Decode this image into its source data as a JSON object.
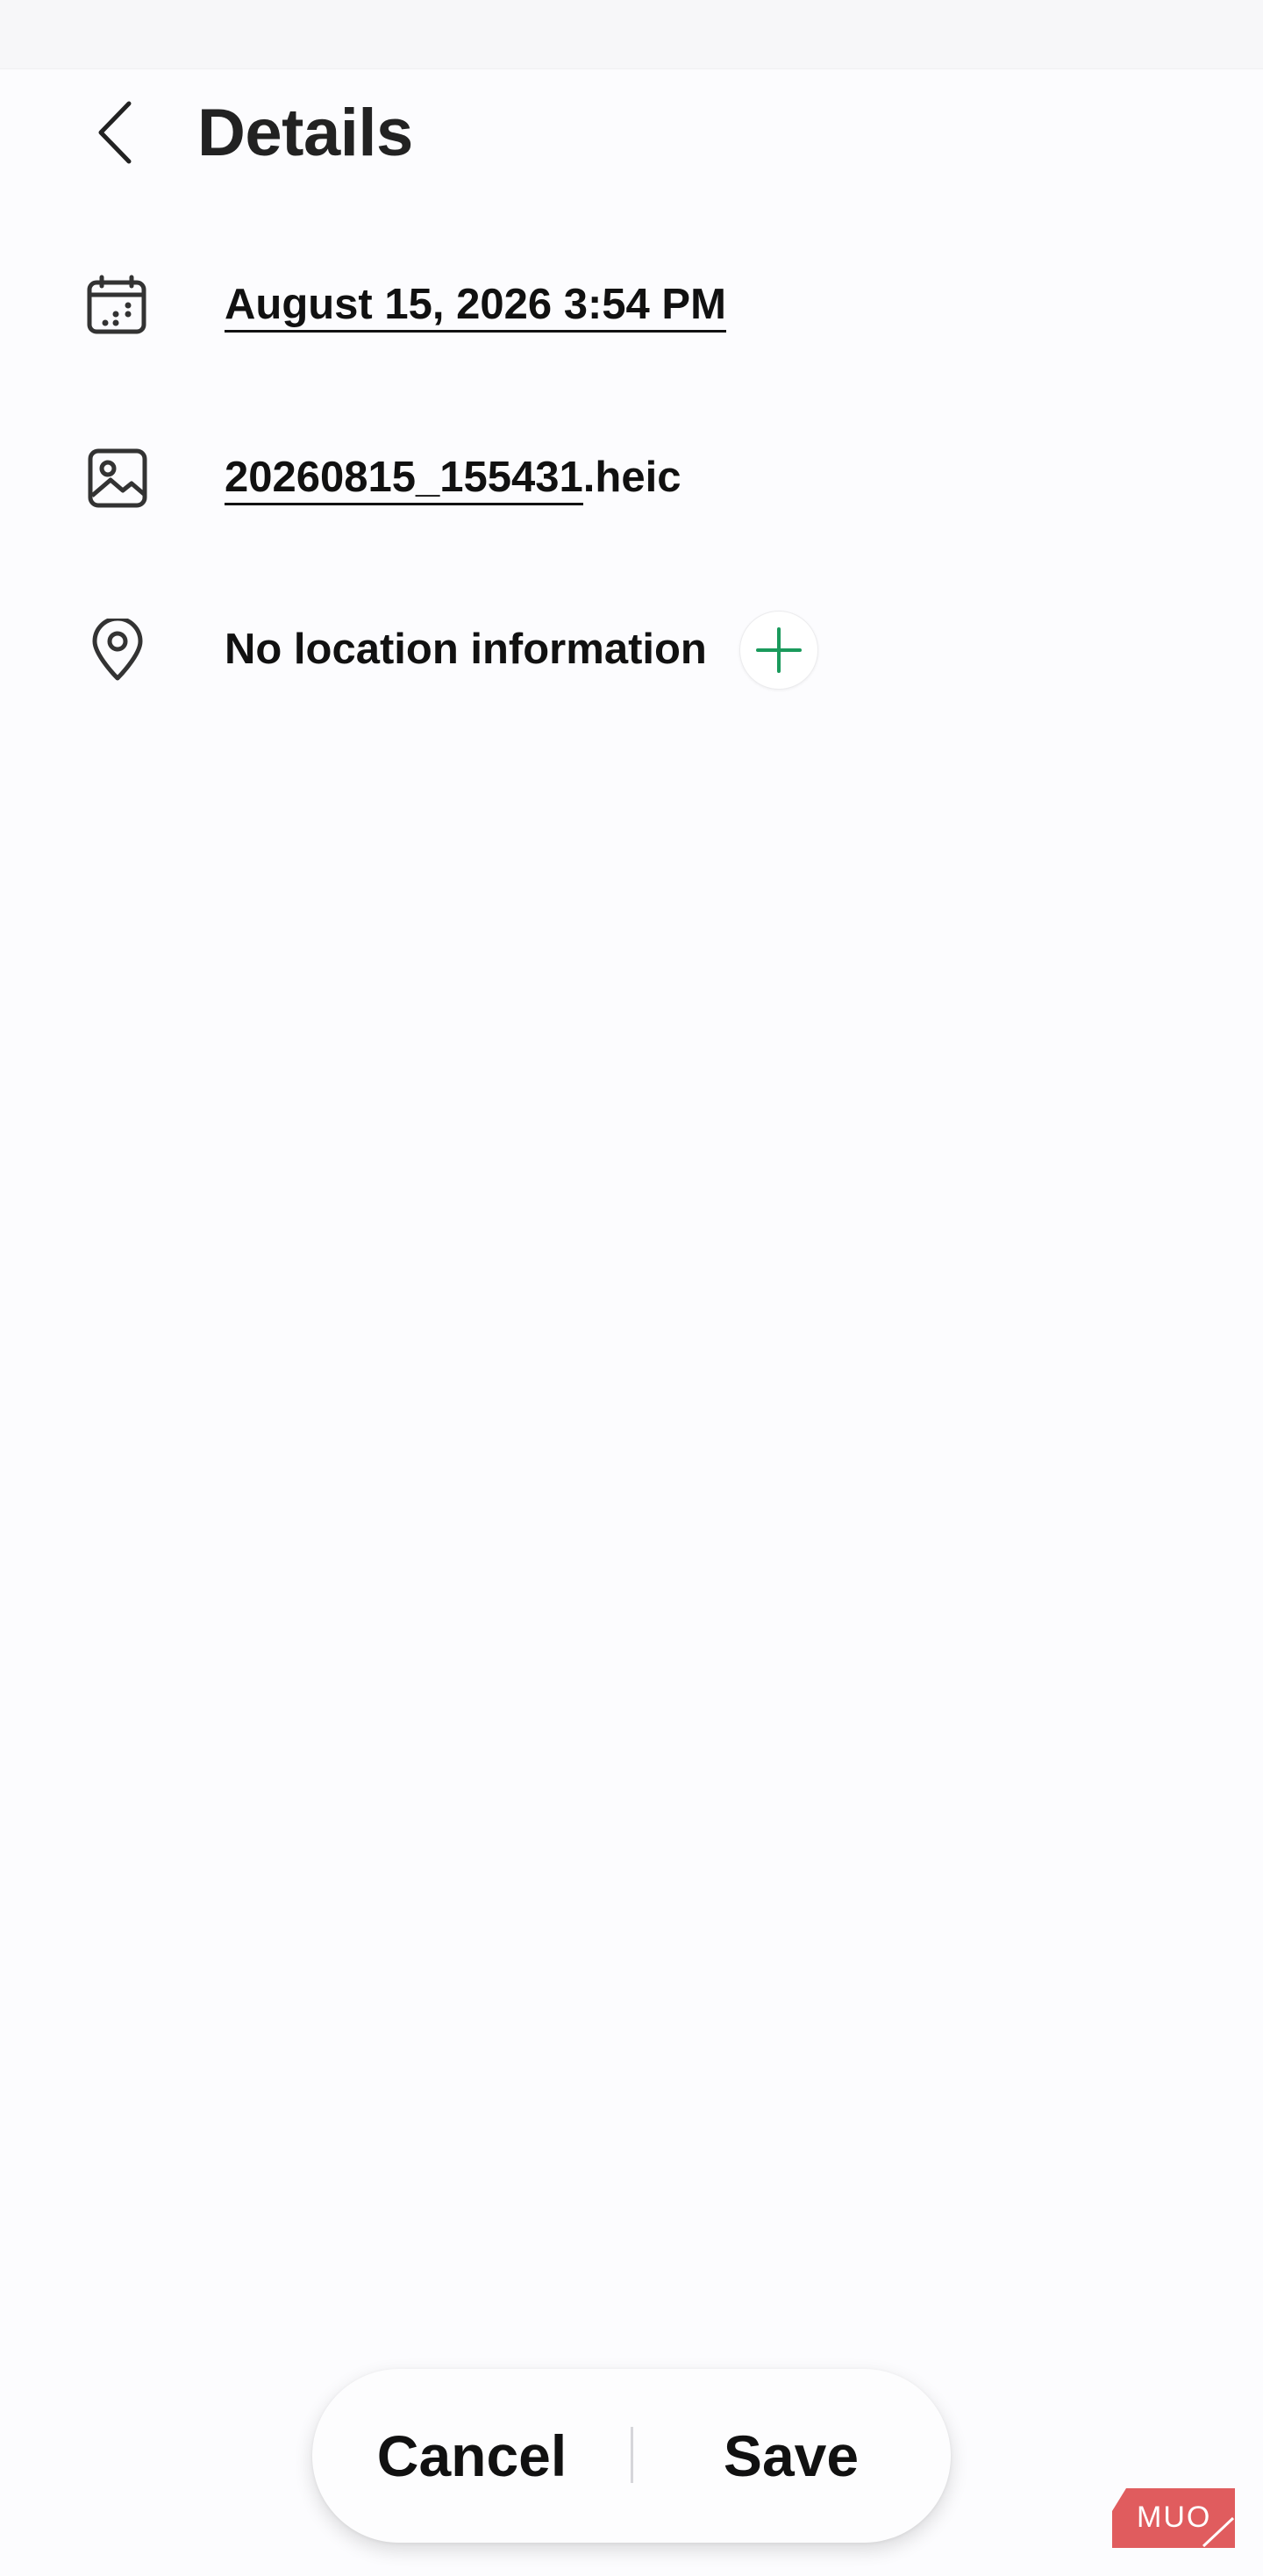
{
  "header": {
    "title": "Details",
    "back_icon": "chevron-left-icon"
  },
  "details": {
    "date": {
      "icon": "calendar-icon",
      "value": "August 15, 2026 3:54 PM"
    },
    "file": {
      "icon": "image-icon",
      "name_base": "20260815_155431",
      "extension": ".heic"
    },
    "location": {
      "icon": "location-pin-icon",
      "value": "No location information",
      "add_icon": "plus-icon"
    }
  },
  "actions": {
    "cancel_label": "Cancel",
    "save_label": "Save"
  },
  "watermark": {
    "text": "MUO",
    "color": "#d9383a"
  },
  "colors": {
    "background": "#fcfcfe",
    "text": "#111111",
    "accent_green": "#1a9a5c"
  }
}
